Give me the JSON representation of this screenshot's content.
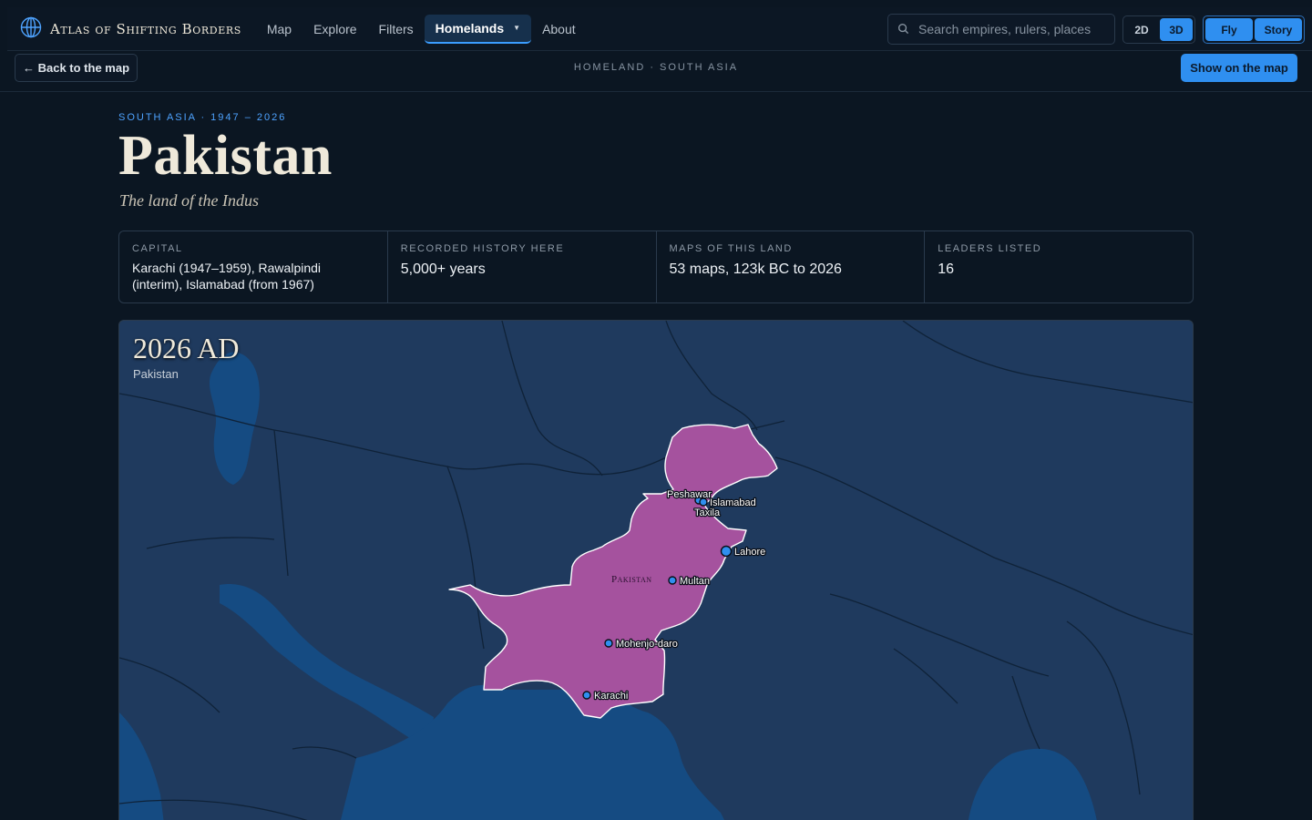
{
  "app": {
    "name": "Atlas of Shifting Borders"
  },
  "nav": {
    "items": [
      {
        "label": "Map"
      },
      {
        "label": "Explore"
      },
      {
        "label": "Filters"
      },
      {
        "label": "Homelands"
      },
      {
        "label": "About"
      }
    ],
    "active": "Homelands"
  },
  "search": {
    "placeholder": "Search empires, rulers, places"
  },
  "view_toggle": {
    "options": [
      "2D",
      "3D"
    ],
    "selected": "3D"
  },
  "mode_toggle": {
    "options": [
      "Fly",
      "Story"
    ]
  },
  "subbar": {
    "back_label": "← Back to the map",
    "breadcrumb": "HOMELAND · SOUTH ASIA",
    "show_label": "Show on the map"
  },
  "hero": {
    "eyebrow": "SOUTH ASIA · 1947 – 2026",
    "title": "Pakistan",
    "subtitle": "The land of the Indus"
  },
  "stats": [
    {
      "label": "CAPITAL",
      "value": "Karachi (1947–1959), Rawalpindi (interim), Islamabad (from 1967)"
    },
    {
      "label": "RECORDED HISTORY HERE",
      "value": "5,000+ years"
    },
    {
      "label": "MAPS OF THIS LAND",
      "value": "53 maps, 123k BC to 2026"
    },
    {
      "label": "LEADERS LISTED",
      "value": "16"
    }
  ],
  "map": {
    "year": "2026 AD",
    "region": "Pakistan",
    "country_label": "Pakistan",
    "cities": [
      {
        "name": "Peshawar"
      },
      {
        "name": "Islamabad"
      },
      {
        "name": "Taxila"
      },
      {
        "name": "Lahore"
      },
      {
        "name": "Multan"
      },
      {
        "name": "Mohenjo-daro"
      },
      {
        "name": "Karachi"
      }
    ]
  },
  "colors": {
    "accent": "#2f8ff0",
    "land": "#1f3a5e",
    "sea": "#154b82",
    "highlight": "#a5529e",
    "border": "#0f2238",
    "background": "#0b1622"
  }
}
